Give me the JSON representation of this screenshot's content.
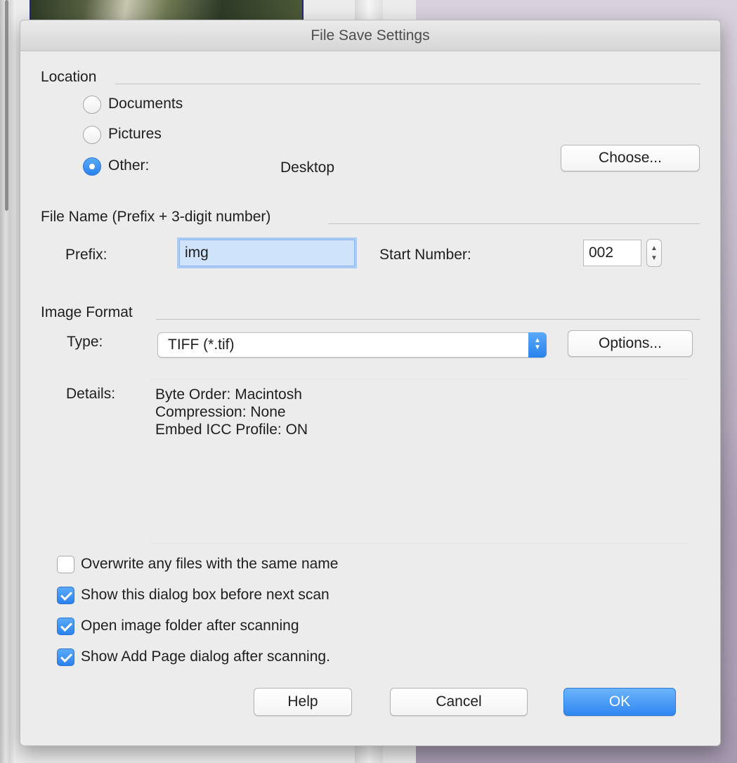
{
  "dialog": {
    "title": "File Save Settings",
    "accent_color": "#2f87f2"
  },
  "location": {
    "section_label": "Location",
    "options": [
      {
        "label": "Documents",
        "selected": false
      },
      {
        "label": "Pictures",
        "selected": false
      },
      {
        "label": "Other:",
        "selected": true
      }
    ],
    "other_path": "Desktop",
    "choose_label": "Choose..."
  },
  "file_name": {
    "section_label": "File Name (Prefix + 3-digit number)",
    "prefix_label": "Prefix:",
    "prefix_value": "img",
    "start_number_label": "Start Number:",
    "start_number_value": "002"
  },
  "image_format": {
    "section_label": "Image Format",
    "type_label": "Type:",
    "type_value": "TIFF (*.tif)",
    "options_label": "Options...",
    "details_label": "Details:",
    "details": [
      "Byte Order: Macintosh",
      "Compression: None",
      "Embed ICC Profile: ON"
    ]
  },
  "checkboxes": [
    {
      "label": "Overwrite any files with the same name",
      "checked": false
    },
    {
      "label": "Show this dialog box before next scan",
      "checked": true
    },
    {
      "label": "Open image folder after scanning",
      "checked": true
    },
    {
      "label": "Show Add Page dialog after scanning.",
      "checked": true
    }
  ],
  "buttons": {
    "help": "Help",
    "cancel": "Cancel",
    "ok": "OK"
  }
}
